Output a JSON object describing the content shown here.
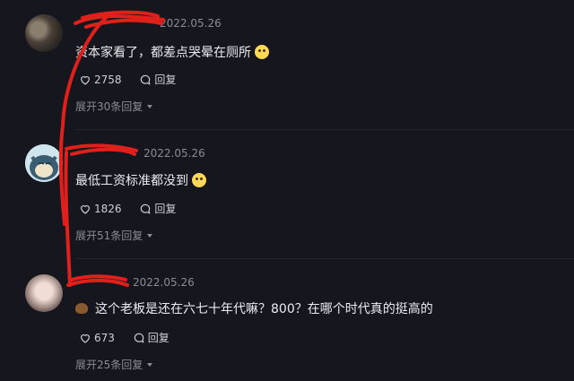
{
  "comments": [
    {
      "username": "",
      "date": "2022.05.26",
      "text": "资本家看了，都差点哭晕在厕所",
      "emoji": "pleading-face-emoji",
      "likes": "2758",
      "reply_label": "回复",
      "expand_label": "展开30条回复"
    },
    {
      "username": "",
      "date": "2022.05.26",
      "text": "最低工资标准都没到",
      "emoji": "grinning-sweat-emoji",
      "likes": "1826",
      "reply_label": "回复",
      "expand_label": "展开51条回复"
    },
    {
      "username": "",
      "date": "2022.05.26",
      "lead_emoji": "poop-emoji",
      "text": "这个老板是还在六七十年代嘛？800？在哪个时代真的挺高的",
      "likes": "673",
      "reply_label": "回复",
      "expand_label": "展开25条回复"
    }
  ],
  "colors": {
    "background": "#16161f",
    "meta_text": "#8b8b96",
    "body_text": "#ebebef",
    "redaction_scribble": "#e0201a"
  },
  "icons": [
    "heart-icon",
    "comment-bubble-icon",
    "caret-down-icon"
  ]
}
